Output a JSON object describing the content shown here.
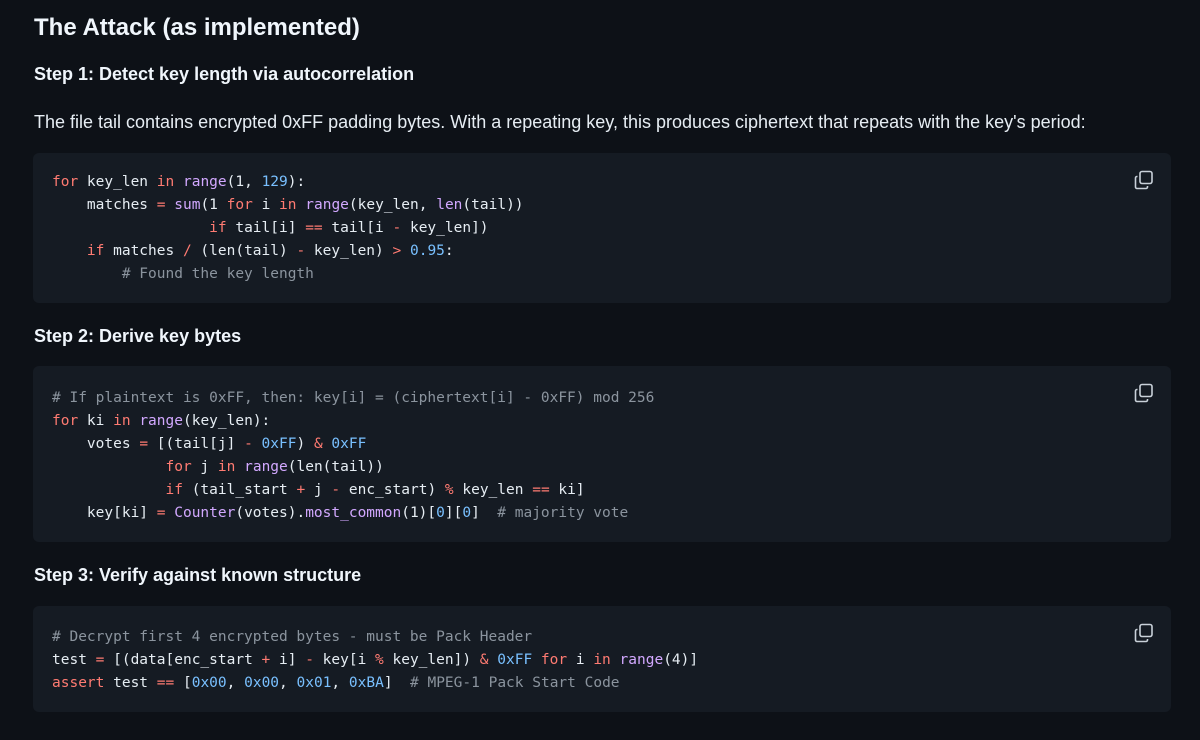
{
  "title": "The Attack (as implemented)",
  "steps": [
    {
      "heading": "Step 1: Detect key length via autocorrelation",
      "intro": "The file tail contains encrypted 0xFF padding bytes. With a repeating key, this produces ciphertext that repeats with the key's period:",
      "code": [
        [
          [
            "kw",
            "for"
          ],
          [
            "id",
            " key_len "
          ],
          [
            "kw",
            "in"
          ],
          [
            "id",
            " "
          ],
          [
            "fn",
            "range"
          ],
          [
            "id",
            "(1, "
          ],
          [
            "num",
            "129"
          ],
          [
            "id",
            "):"
          ]
        ],
        [
          [
            "id",
            "    matches "
          ],
          [
            "op",
            "="
          ],
          [
            "id",
            " "
          ],
          [
            "fn",
            "sum"
          ],
          [
            "id",
            "(1 "
          ],
          [
            "kw",
            "for"
          ],
          [
            "id",
            " i "
          ],
          [
            "kw",
            "in"
          ],
          [
            "id",
            " "
          ],
          [
            "fn",
            "range"
          ],
          [
            "id",
            "(key_len, "
          ],
          [
            "fn",
            "len"
          ],
          [
            "id",
            "(tail))"
          ]
        ],
        [
          [
            "id",
            "                  "
          ],
          [
            "kw",
            "if"
          ],
          [
            "id",
            " tail[i] "
          ],
          [
            "op",
            "=="
          ],
          [
            "id",
            " tail[i "
          ],
          [
            "op",
            "-"
          ],
          [
            "id",
            " key_len])"
          ]
        ],
        [
          [
            "id",
            "    "
          ],
          [
            "kw",
            "if"
          ],
          [
            "id",
            " matches "
          ],
          [
            "op",
            "/"
          ],
          [
            "id",
            " (len(tail) "
          ],
          [
            "op",
            "-"
          ],
          [
            "id",
            " key_len) "
          ],
          [
            "op",
            ">"
          ],
          [
            "id",
            " "
          ],
          [
            "num",
            "0.95"
          ],
          [
            "id",
            ":"
          ]
        ],
        [
          [
            "cm",
            "        # Found the key length"
          ]
        ]
      ]
    },
    {
      "heading": "Step 2: Derive key bytes",
      "code": [
        [
          [
            "cm",
            "# If plaintext is 0xFF, then: key[i] = (ciphertext[i] - 0xFF) mod 256"
          ]
        ],
        [
          [
            "kw",
            "for"
          ],
          [
            "id",
            " ki "
          ],
          [
            "kw",
            "in"
          ],
          [
            "id",
            " "
          ],
          [
            "fn",
            "range"
          ],
          [
            "id",
            "(key_len):"
          ]
        ],
        [
          [
            "id",
            "    votes "
          ],
          [
            "op",
            "="
          ],
          [
            "id",
            " [(tail[j] "
          ],
          [
            "op",
            "-"
          ],
          [
            "id",
            " "
          ],
          [
            "num",
            "0xFF"
          ],
          [
            "id",
            ") "
          ],
          [
            "op",
            "&"
          ],
          [
            "id",
            " "
          ],
          [
            "num",
            "0xFF"
          ]
        ],
        [
          [
            "id",
            "             "
          ],
          [
            "kw",
            "for"
          ],
          [
            "id",
            " j "
          ],
          [
            "kw",
            "in"
          ],
          [
            "id",
            " "
          ],
          [
            "fn",
            "range"
          ],
          [
            "id",
            "(len(tail))"
          ]
        ],
        [
          [
            "id",
            "             "
          ],
          [
            "kw",
            "if"
          ],
          [
            "id",
            " (tail_start "
          ],
          [
            "op",
            "+"
          ],
          [
            "id",
            " j "
          ],
          [
            "op",
            "-"
          ],
          [
            "id",
            " enc_start) "
          ],
          [
            "op",
            "%"
          ],
          [
            "id",
            " key_len "
          ],
          [
            "op",
            "=="
          ],
          [
            "id",
            " ki]"
          ]
        ],
        [
          [
            "id",
            "    key[ki] "
          ],
          [
            "op",
            "="
          ],
          [
            "id",
            " "
          ],
          [
            "fn",
            "Counter"
          ],
          [
            "id",
            "(votes)."
          ],
          [
            "fn",
            "most_common"
          ],
          [
            "id",
            "(1)["
          ],
          [
            "num",
            "0"
          ],
          [
            "id",
            "]["
          ],
          [
            "num",
            "0"
          ],
          [
            "id",
            "]  "
          ],
          [
            "cm",
            "# majority vote"
          ]
        ]
      ]
    },
    {
      "heading": "Step 3: Verify against known structure",
      "code": [
        [
          [
            "cm",
            "# Decrypt first 4 encrypted bytes - must be Pack Header"
          ]
        ],
        [
          [
            "id",
            "test "
          ],
          [
            "op",
            "="
          ],
          [
            "id",
            " [(data[enc_start "
          ],
          [
            "op",
            "+"
          ],
          [
            "id",
            " i] "
          ],
          [
            "op",
            "-"
          ],
          [
            "id",
            " key[i "
          ],
          [
            "op",
            "%"
          ],
          [
            "id",
            " key_len]) "
          ],
          [
            "op",
            "&"
          ],
          [
            "id",
            " "
          ],
          [
            "num",
            "0xFF"
          ],
          [
            "id",
            " "
          ],
          [
            "kw",
            "for"
          ],
          [
            "id",
            " i "
          ],
          [
            "kw",
            "in"
          ],
          [
            "id",
            " "
          ],
          [
            "fn",
            "range"
          ],
          [
            "id",
            "(4)]"
          ]
        ],
        [
          [
            "kw",
            "assert"
          ],
          [
            "id",
            " test "
          ],
          [
            "op",
            "=="
          ],
          [
            "id",
            " ["
          ],
          [
            "num",
            "0x00"
          ],
          [
            "id",
            ", "
          ],
          [
            "num",
            "0x00"
          ],
          [
            "id",
            ", "
          ],
          [
            "num",
            "0x01"
          ],
          [
            "id",
            ", "
          ],
          [
            "num",
            "0xBA"
          ],
          [
            "id",
            "]  "
          ],
          [
            "cm",
            "# MPEG-1 Pack Start Code"
          ]
        ]
      ]
    }
  ],
  "icons": {
    "copy": "copy-icon"
  },
  "colors": {
    "bg": "#0d1117",
    "code_bg": "#151b23",
    "keyword": "#ff7b72",
    "function": "#d2a8ff",
    "number": "#79c0ff",
    "comment": "#8b949e"
  }
}
